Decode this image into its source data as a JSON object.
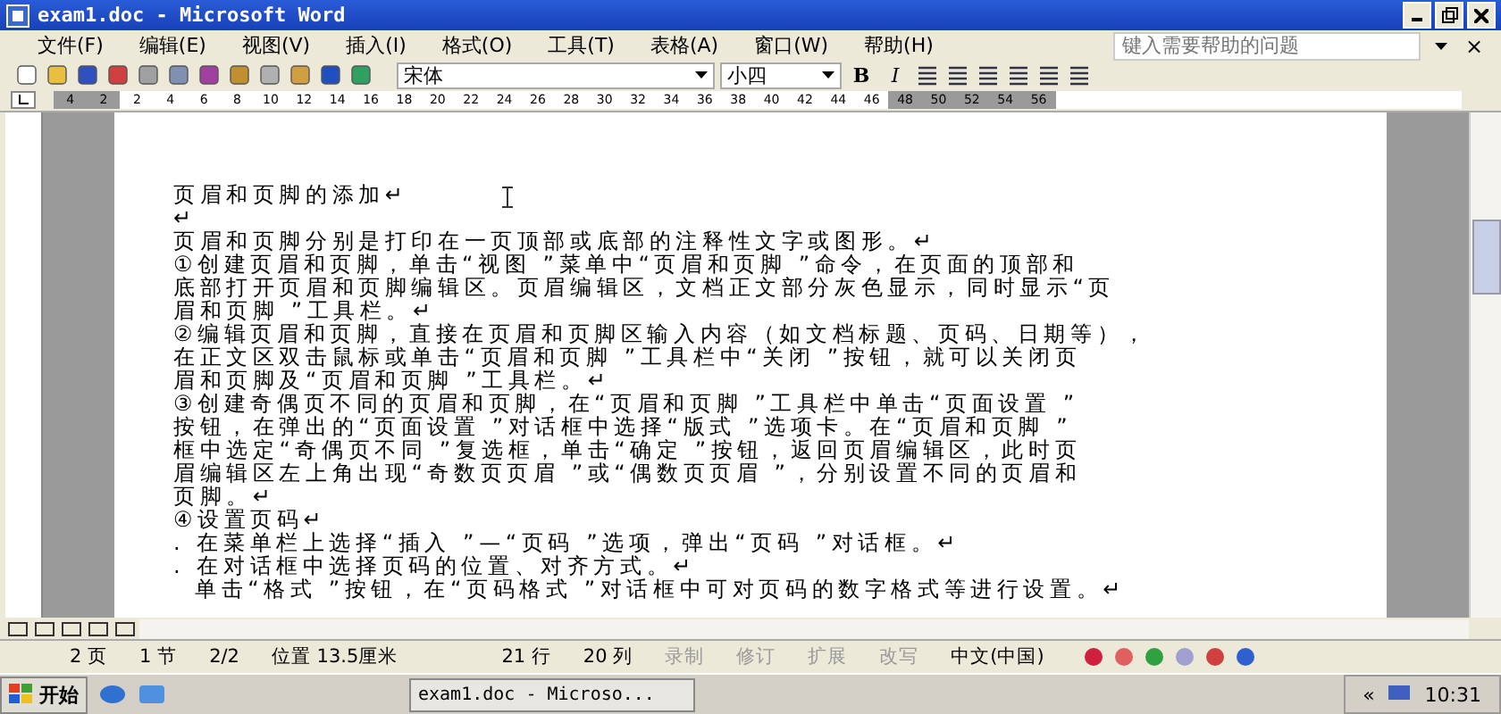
{
  "window": {
    "title": "exam1.doc - Microsoft Word"
  },
  "menu": [
    "文件(F)",
    "编辑(E)",
    "视图(V)",
    "插入(I)",
    "格式(O)",
    "工具(T)",
    "表格(A)",
    "窗口(W)",
    "帮助(H)"
  ],
  "help_box": {
    "placeholder": "键入需要帮助的问题",
    "close": "×"
  },
  "toolbar": {
    "font": "宋体",
    "size": "小四",
    "bold": "B",
    "italic": "I"
  },
  "ruler": [
    {
      "label": "4",
      "margin": true
    },
    {
      "label": "2",
      "margin": true
    },
    {
      "label": "2",
      "margin": false
    },
    {
      "label": "4",
      "margin": false
    },
    {
      "label": "6",
      "margin": false
    },
    {
      "label": "8",
      "margin": false
    },
    {
      "label": "10",
      "margin": false
    },
    {
      "label": "12",
      "margin": false
    },
    {
      "label": "14",
      "margin": false
    },
    {
      "label": "16",
      "margin": false
    },
    {
      "label": "18",
      "margin": false
    },
    {
      "label": "20",
      "margin": false
    },
    {
      "label": "22",
      "margin": false
    },
    {
      "label": "24",
      "margin": false
    },
    {
      "label": "26",
      "margin": false
    },
    {
      "label": "28",
      "margin": false
    },
    {
      "label": "30",
      "margin": false
    },
    {
      "label": "32",
      "margin": false
    },
    {
      "label": "34",
      "margin": false
    },
    {
      "label": "36",
      "margin": false
    },
    {
      "label": "38",
      "margin": false
    },
    {
      "label": "40",
      "margin": false
    },
    {
      "label": "42",
      "margin": false
    },
    {
      "label": "44",
      "margin": false
    },
    {
      "label": "46",
      "margin": false
    },
    {
      "label": "48",
      "margin": true
    },
    {
      "label": "50",
      "margin": true
    },
    {
      "label": "52",
      "margin": true
    },
    {
      "label": "54",
      "margin": true
    },
    {
      "label": "56",
      "margin": true
    }
  ],
  "document": {
    "paragraphs": [
      {
        "lines": [
          "页眉和页脚的添加↵"
        ]
      },
      {
        "lines": [
          "↵"
        ]
      },
      {
        "lines": [
          "页眉和页脚分别是打印在一页顶部或底部的注释性文字或图形。↵"
        ]
      },
      {
        "lines": [
          "①创建页眉和页脚，单击“视图 ”菜单中“页眉和页脚 ”命令，在页面的顶部和",
          "底部打开页眉和页脚编辑区。页眉编辑区，文档正文部分灰色显示，同时显示“页",
          "眉和页脚 ”工具栏。↵"
        ]
      },
      {
        "lines": [
          "②编辑页眉和页脚，直接在页眉和页脚区输入内容（如文档标题、页码、日期等），",
          "在正文区双击鼠标或单击“页眉和页脚 ”工具栏中“关闭 ”按钮，就可以关闭页",
          "眉和页脚及“页眉和页脚 ”工具栏。↵"
        ]
      },
      {
        "lines": [
          "③创建奇偶页不同的页眉和页脚，在“页眉和页脚 ”工具栏中单击“页面设置 ”",
          "按钮，在弹出的“页面设置 ”对话框中选择“版式 ”选项卡。在“页眉和页脚 ”",
          "框中选定“奇偶页不同 ”复选框，单击“确定 ”按钮，返回页眉编辑区，此时页",
          "眉编辑区左上角出现“奇数页页眉 ”或“偶数页页眉 ”，分别设置不同的页眉和",
          "页脚。↵"
        ]
      },
      {
        "lines": [
          "④设置页码↵"
        ]
      },
      {
        "lines": [
          ". 在菜单栏上选择“插入 ”—“页码 ”选项，弹出“页码 ”对话框。↵"
        ]
      },
      {
        "lines": [
          ". 在对话框中选择页码的位置、对齐方式。↵"
        ]
      },
      {
        "lines": [
          "单击“格式 ”按钮，在“页码格式 ”对话框中可对页码的数字格式等进行设置。↵"
        ]
      }
    ]
  },
  "status_bar": [
    {
      "text": "2 页",
      "disabled": false
    },
    {
      "text": "1 节",
      "disabled": false
    },
    {
      "text": "2/2",
      "disabled": false
    },
    {
      "text": "位置 13.5厘米",
      "disabled": false
    },
    {
      "text": "21 行",
      "disabled": false
    },
    {
      "text": "20 列",
      "disabled": false
    },
    {
      "text": "录制",
      "disabled": true
    },
    {
      "text": "修订",
      "disabled": true
    },
    {
      "text": "扩展",
      "disabled": true
    },
    {
      "text": "改写",
      "disabled": true
    },
    {
      "text": "中文(中国)",
      "disabled": false
    }
  ],
  "taskbar": {
    "start": "开始",
    "task": "exam1.doc - Microso...",
    "tray_arrow": "«",
    "clock": "10:31"
  }
}
